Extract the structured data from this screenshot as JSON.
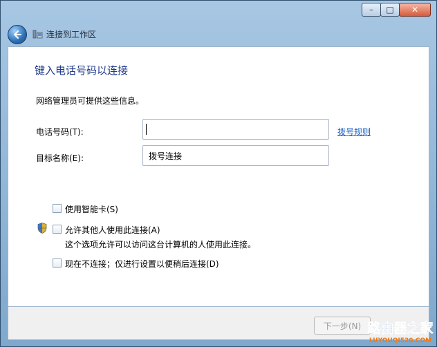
{
  "window": {
    "title": "连接到工作区",
    "caption": {
      "minimize_symbol": "–",
      "maximize_symbol": "□",
      "close_symbol": "✕"
    }
  },
  "page": {
    "heading": "键入电话号码以连接",
    "info": "网络管理员可提供这些信息。",
    "phone": {
      "label": "电话号码(T):",
      "value": ""
    },
    "dial_rules_link": "拨号规则",
    "destination": {
      "label": "目标名称(E):",
      "value": "拨号连接"
    },
    "checkboxes": [
      {
        "label": "使用智能卡(S)",
        "checked": false
      },
      {
        "label": "允许其他人使用此连接(A)",
        "checked": false
      },
      {
        "label": "现在不连接；仅进行设置以便稍后连接(D)",
        "checked": false
      }
    ],
    "allow_others_description": "这个选项允许可以访问这台计算机的人使用此连接。"
  },
  "footer": {
    "next_button": "下一步(N)"
  },
  "watermark": {
    "text": "路由器之家",
    "url_text": "LUYOUQI520.COM",
    "colors": {
      "main": "#1e5fb2",
      "sub": "#e87c1e"
    }
  },
  "icons": {
    "back": "back-arrow-icon",
    "window": "network-connection-icon",
    "uac": "uac-shield-icon"
  },
  "colors": {
    "heading": "#1e3a8a",
    "link": "#1f62c9",
    "close_button": "#d55b3d"
  }
}
